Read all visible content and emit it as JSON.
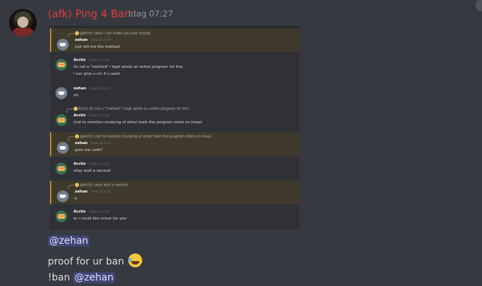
{
  "message": {
    "author": "(afk) Ping 4 Ban",
    "timestamp": "Idag 07:27",
    "author_color": "#e03e3e",
    "mention_user": "@zehan",
    "text_line": "proof for ur ban",
    "emoji": "rolling-on-floor-laughing-emoji",
    "command": "!ban"
  },
  "screenshot": {
    "messages": [
      {
        "reply": "@Arctic okay i can make you one maybe",
        "avatar": "discord-default",
        "author": "zehan",
        "time": "Today at 21:49",
        "lines": [
          "just tell me the method"
        ],
        "highlighted": true
      },
      {
        "reply": "",
        "avatar": "arctic",
        "author": "Arctic",
        "time": "Today at 21:49",
        "lines": [
          "its not a \"method\" i legit wrote an entire program for this",
          "i can give u src if u want"
        ],
        "highlighted": false
      },
      {
        "reply": "",
        "avatar": "discord-default",
        "author": "zehan",
        "time": "Today at 21:50",
        "lines": [
          "oh"
        ],
        "highlighted": false
      },
      {
        "reply": "Arctic its not a \"method\" i legit wrote an entire program for this",
        "avatar": "arctic",
        "author": "Arctic",
        "time": "Today at 21:50",
        "lines": [
          "(not to mention studying of other tools the program relies on lmao)"
        ],
        "highlighted": false
      },
      {
        "reply": "@Arctic (not to mention studying of other tools the program relies on lmao)",
        "avatar": "discord-default",
        "author": "zehan",
        "time": "Today at 21:50",
        "lines": [
          "give me code?"
        ],
        "highlighted": true
      },
      {
        "reply": "",
        "avatar": "arctic",
        "author": "Arctic",
        "time": "Today at 21:51",
        "lines": [
          "okay wait a second"
        ],
        "highlighted": false
      },
      {
        "reply": "@Arctic okay wait a second",
        "avatar": "discord-default",
        "author": "zehan",
        "time": "Today at 21:51",
        "lines": [
          "k"
        ],
        "highlighted": true
      },
      {
        "reply": "",
        "avatar": "arctic",
        "author": "Arctic",
        "time": "Today at 21:52",
        "lines": [
          "or i could dev miner for you"
        ],
        "highlighted": false
      }
    ]
  },
  "colors": {
    "background": "#36393f",
    "mention_bg": "#414675",
    "mention_fg": "#dee0fc",
    "highlight_bar": "#b78d2d"
  }
}
